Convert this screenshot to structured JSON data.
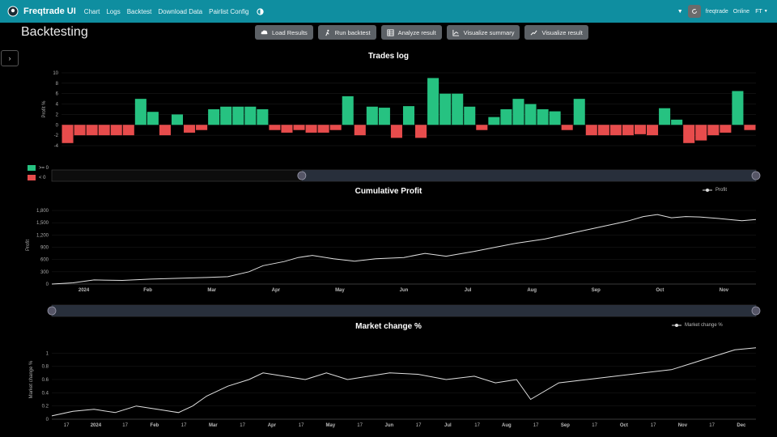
{
  "navbar": {
    "brand": "Freqtrade UI",
    "links": [
      "Chart",
      "Logs",
      "Backtest",
      "Download Data",
      "Pairlist Config"
    ],
    "bot_name": "freqtrade",
    "status": "Online",
    "avatar_initials": "FT",
    "bg_color": "#0f8ea0"
  },
  "page": {
    "title": "Backtesting"
  },
  "toolbar": {
    "buttons": [
      {
        "label": "Load Results",
        "icon": "cloud-upload-icon"
      },
      {
        "label": "Run backtest",
        "icon": "run-icon"
      },
      {
        "label": "Analyze result",
        "icon": "table-icon"
      },
      {
        "label": "Visualize summary",
        "icon": "chart-line-icon"
      },
      {
        "label": "Visualize result",
        "icon": "chart-trend-icon"
      }
    ]
  },
  "trades_log": {
    "title": "Trades log",
    "ylabel": "Profit %",
    "legend": [
      ">= 0",
      "< 0"
    ],
    "colors": {
      "positive": "#26c281",
      "negative": "#e74c4c"
    }
  },
  "cumulative": {
    "title": "Cumulative Profit",
    "legend": "Profit"
  },
  "market": {
    "title": "Market change %",
    "legend": "Market change %"
  },
  "chart_data": [
    {
      "type": "bar",
      "title": "Trades log",
      "ylabel": "Profit %",
      "ylim": [
        -4,
        10
      ],
      "yticks": [
        -4,
        -2,
        0,
        2,
        4,
        6,
        8,
        10
      ],
      "values": [
        -3.5,
        -2,
        -2,
        -2,
        -2,
        -2,
        5,
        2.5,
        -2,
        2,
        -1.5,
        -1,
        3,
        3.5,
        3.5,
        3.5,
        3,
        -1,
        -1.5,
        -1,
        -1.5,
        -1.5,
        -1,
        5.5,
        -2,
        3.5,
        3.3,
        -2.5,
        3.6,
        -2.5,
        9,
        6,
        6,
        3.5,
        -1,
        1.5,
        3,
        5,
        4,
        3,
        2.6,
        -1,
        5,
        -2,
        -2,
        -2,
        -2,
        -1.8,
        -2,
        3.2,
        1,
        -3.5,
        -3,
        -2,
        -1.5,
        6.5,
        -1
      ]
    },
    {
      "type": "line",
      "title": "Cumulative Profit",
      "ylabel": "Profit",
      "ylim": [
        0,
        1900
      ],
      "yticks": [
        0,
        300,
        600,
        900,
        1200,
        1500,
        1800
      ],
      "xticks": [
        "2024",
        "Feb",
        "Mar",
        "Apr",
        "May",
        "Jun",
        "Jul",
        "Aug",
        "Sep",
        "Oct",
        "Nov"
      ],
      "x": [
        0,
        0.03,
        0.06,
        0.1,
        0.14,
        0.18,
        0.22,
        0.25,
        0.28,
        0.3,
        0.33,
        0.35,
        0.37,
        0.4,
        0.43,
        0.46,
        0.5,
        0.53,
        0.56,
        0.6,
        0.63,
        0.66,
        0.7,
        0.74,
        0.78,
        0.82,
        0.84,
        0.86,
        0.88,
        0.9,
        0.92,
        0.95,
        0.98,
        1.0
      ],
      "values": [
        0,
        30,
        100,
        90,
        120,
        140,
        160,
        180,
        300,
        450,
        550,
        650,
        700,
        620,
        560,
        620,
        650,
        750,
        680,
        800,
        900,
        1000,
        1100,
        1250,
        1400,
        1550,
        1650,
        1700,
        1620,
        1650,
        1640,
        1600,
        1550,
        1580
      ]
    },
    {
      "type": "line",
      "title": "Market change %",
      "ylabel": "Market change %",
      "ylim": [
        0,
        1.2
      ],
      "yticks": [
        0,
        0.2,
        0.4,
        0.6,
        0.8,
        1
      ],
      "xticks": [
        "17",
        "2024",
        "17",
        "Feb",
        "17",
        "Mar",
        "17",
        "Apr",
        "17",
        "May",
        "17",
        "Jun",
        "17",
        "Jul",
        "17",
        "Aug",
        "17",
        "Sep",
        "17",
        "Oct",
        "17",
        "Nov",
        "17",
        "Dec"
      ],
      "x": [
        0,
        0.03,
        0.06,
        0.09,
        0.12,
        0.15,
        0.18,
        0.2,
        0.22,
        0.25,
        0.28,
        0.3,
        0.33,
        0.36,
        0.39,
        0.42,
        0.45,
        0.48,
        0.52,
        0.56,
        0.6,
        0.63,
        0.66,
        0.68,
        0.72,
        0.76,
        0.8,
        0.84,
        0.88,
        0.91,
        0.94,
        0.97,
        1.0
      ],
      "values": [
        0.05,
        0.12,
        0.15,
        0.1,
        0.2,
        0.15,
        0.1,
        0.2,
        0.35,
        0.5,
        0.6,
        0.7,
        0.65,
        0.6,
        0.7,
        0.6,
        0.65,
        0.7,
        0.68,
        0.6,
        0.65,
        0.55,
        0.6,
        0.3,
        0.55,
        0.6,
        0.65,
        0.7,
        0.75,
        0.85,
        0.95,
        1.05,
        1.08
      ]
    }
  ]
}
